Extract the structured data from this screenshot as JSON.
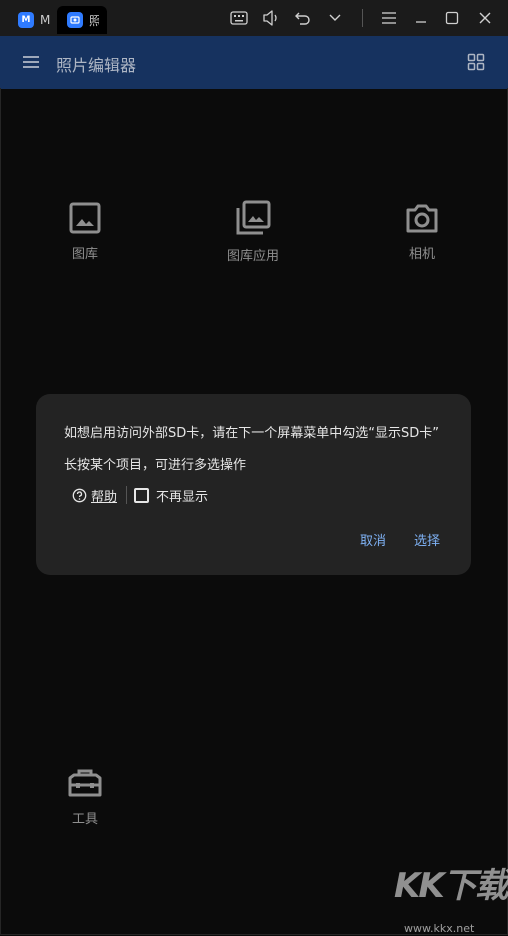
{
  "window": {
    "tabs": [
      {
        "label": "M"
      },
      {
        "label": "照"
      }
    ]
  },
  "appbar": {
    "title": "照片编辑器",
    "menu_icon": "hamburger-icon",
    "grid_icon": "grid-icon",
    "color": "#16325f"
  },
  "tiles": [
    {
      "label": "图库",
      "icon": "image-icon"
    },
    {
      "label": "图库应用",
      "icon": "images-stack-icon"
    },
    {
      "label": "相机",
      "icon": "camera-icon"
    },
    {
      "label": "工具",
      "icon": "toolbox-icon"
    }
  ],
  "dialog": {
    "message_sd": "如想启用访问外部SD卡，请在下一个屏幕菜单中勾选“显示SD卡”",
    "message_multiselect": "长按某个项目，可进行多选操作",
    "help_label": "帮助",
    "dont_show_label": "不再显示",
    "dont_show_checked": false,
    "cancel_label": "取消",
    "select_label": "选择",
    "accent": "#7fb2f5"
  },
  "watermark": {
    "text": "KK下载",
    "url": "www.kkx.net"
  }
}
